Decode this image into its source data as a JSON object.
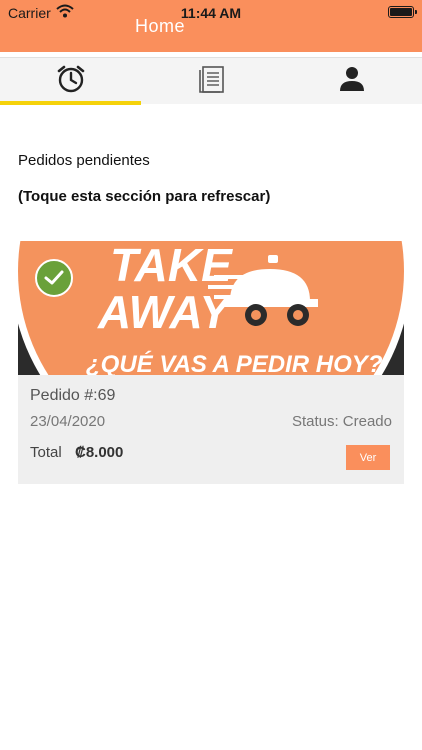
{
  "status_bar": {
    "carrier": "Carrier",
    "time": "11:44 AM"
  },
  "nav": {
    "title": "Home"
  },
  "tabs": [
    {
      "icon": "alarm-clock-icon",
      "active": true
    },
    {
      "icon": "document-list-icon",
      "active": false
    },
    {
      "icon": "user-icon",
      "active": false
    }
  ],
  "content": {
    "pending_label": "Pedidos pendientes",
    "refresh_hint": "(Toque esta sección para refrescar)"
  },
  "order": {
    "banner": {
      "line1": "TAKE",
      "line2": "AWAY",
      "tagline": "¿QUÉ VAS A PEDIR HOY?"
    },
    "number": "Pedido #:69",
    "date": "23/04/2020",
    "status": "Status: Creado",
    "total_label": "Total",
    "total_value": "₡8.000",
    "view_label": "Ver"
  },
  "colors": {
    "accent": "#fa8f5c",
    "tab_indicator": "#f5d20a",
    "check": "#6aa13a"
  }
}
